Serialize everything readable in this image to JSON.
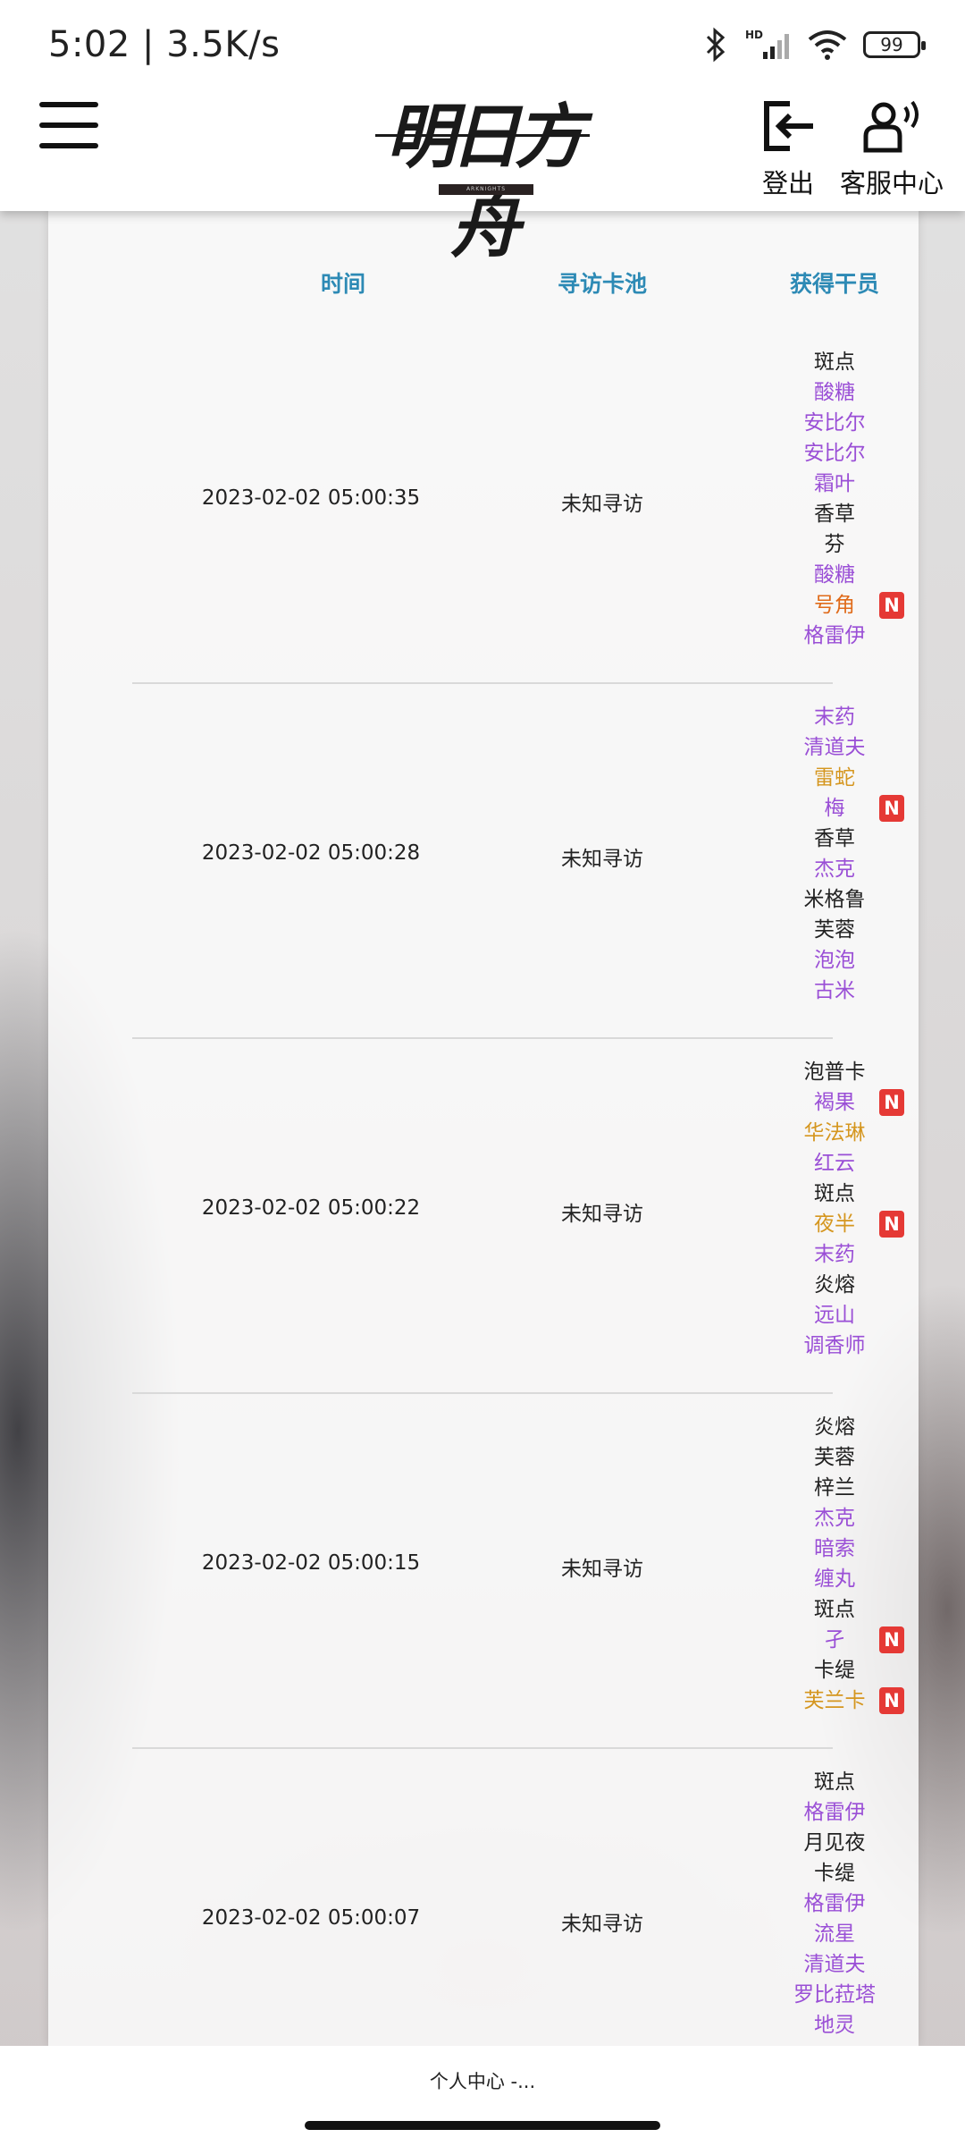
{
  "status_bar": {
    "time": "5:02",
    "speed": "3.5K/s",
    "battery": "99",
    "hd": "HD"
  },
  "header": {
    "logo_text": "明日方舟",
    "logo_subtext": "ARKNIGHTS",
    "logout_label": "登出",
    "service_label": "客服中心"
  },
  "table": {
    "headers": {
      "time": "时间",
      "pool": "寻访卡池",
      "operators": "获得干员"
    },
    "rows": [
      {
        "time": "2023-02-02 05:00:35",
        "pool": "未知寻访",
        "operators": [
          {
            "name": "斑点",
            "rarity": 3,
            "new": false
          },
          {
            "name": "酸糖",
            "rarity": 4,
            "new": false
          },
          {
            "name": "安比尔",
            "rarity": 4,
            "new": false
          },
          {
            "name": "安比尔",
            "rarity": 4,
            "new": false
          },
          {
            "name": "霜叶",
            "rarity": 4,
            "new": false
          },
          {
            "name": "香草",
            "rarity": 3,
            "new": false
          },
          {
            "name": "芬",
            "rarity": 3,
            "new": false
          },
          {
            "name": "酸糖",
            "rarity": 4,
            "new": false
          },
          {
            "name": "号角",
            "rarity": 6,
            "new": true
          },
          {
            "name": "格雷伊",
            "rarity": 4,
            "new": false
          }
        ]
      },
      {
        "time": "2023-02-02 05:00:28",
        "pool": "未知寻访",
        "operators": [
          {
            "name": "末药",
            "rarity": 4,
            "new": false
          },
          {
            "name": "清道夫",
            "rarity": 4,
            "new": false
          },
          {
            "name": "雷蛇",
            "rarity": 5,
            "new": false
          },
          {
            "name": "梅",
            "rarity": 4,
            "new": true
          },
          {
            "name": "香草",
            "rarity": 3,
            "new": false
          },
          {
            "name": "杰克",
            "rarity": 4,
            "new": false
          },
          {
            "name": "米格鲁",
            "rarity": 3,
            "new": false
          },
          {
            "name": "芙蓉",
            "rarity": 3,
            "new": false
          },
          {
            "name": "泡泡",
            "rarity": 4,
            "new": false
          },
          {
            "name": "古米",
            "rarity": 4,
            "new": false
          }
        ]
      },
      {
        "time": "2023-02-02 05:00:22",
        "pool": "未知寻访",
        "operators": [
          {
            "name": "泡普卡",
            "rarity": 3,
            "new": false
          },
          {
            "name": "褐果",
            "rarity": 4,
            "new": true
          },
          {
            "name": "华法琳",
            "rarity": 5,
            "new": false
          },
          {
            "name": "红云",
            "rarity": 4,
            "new": false
          },
          {
            "name": "斑点",
            "rarity": 3,
            "new": false
          },
          {
            "name": "夜半",
            "rarity": 5,
            "new": true
          },
          {
            "name": "末药",
            "rarity": 4,
            "new": false
          },
          {
            "name": "炎熔",
            "rarity": 3,
            "new": false
          },
          {
            "name": "远山",
            "rarity": 4,
            "new": false
          },
          {
            "name": "调香师",
            "rarity": 4,
            "new": false
          }
        ]
      },
      {
        "time": "2023-02-02 05:00:15",
        "pool": "未知寻访",
        "operators": [
          {
            "name": "炎熔",
            "rarity": 3,
            "new": false
          },
          {
            "name": "芙蓉",
            "rarity": 3,
            "new": false
          },
          {
            "name": "梓兰",
            "rarity": 3,
            "new": false
          },
          {
            "name": "杰克",
            "rarity": 4,
            "new": false
          },
          {
            "name": "暗索",
            "rarity": 4,
            "new": false
          },
          {
            "name": "缠丸",
            "rarity": 4,
            "new": false
          },
          {
            "name": "斑点",
            "rarity": 3,
            "new": false
          },
          {
            "name": "孑",
            "rarity": 4,
            "new": true
          },
          {
            "name": "卡缇",
            "rarity": 3,
            "new": false
          },
          {
            "name": "芙兰卡",
            "rarity": 5,
            "new": true
          }
        ]
      },
      {
        "time": "2023-02-02 05:00:07",
        "pool": "未知寻访",
        "operators": [
          {
            "name": "斑点",
            "rarity": 3,
            "new": false
          },
          {
            "name": "格雷伊",
            "rarity": 4,
            "new": false
          },
          {
            "name": "月见夜",
            "rarity": 3,
            "new": false
          },
          {
            "name": "卡缇",
            "rarity": 3,
            "new": false
          },
          {
            "name": "格雷伊",
            "rarity": 4,
            "new": false
          },
          {
            "name": "流星",
            "rarity": 4,
            "new": false
          },
          {
            "name": "清道夫",
            "rarity": 4,
            "new": false
          },
          {
            "name": "罗比菈塔",
            "rarity": 4,
            "new": false
          },
          {
            "name": "地灵",
            "rarity": 4,
            "new": false
          }
        ]
      }
    ],
    "new_badge": "N"
  },
  "bottom_bar": {
    "page_title": "个人中心 -..."
  }
}
